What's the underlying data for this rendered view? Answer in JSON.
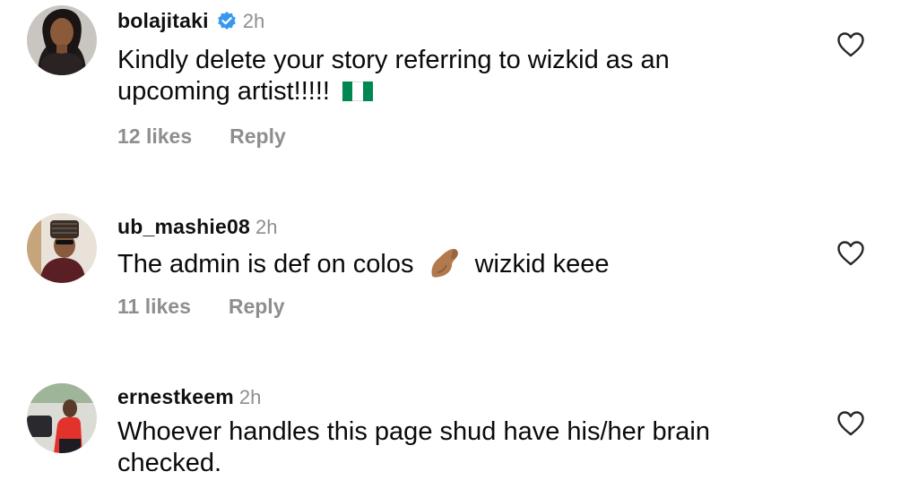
{
  "comments": [
    {
      "username": "bolajitaki",
      "verified": true,
      "time": "2h",
      "text": "Kindly delete your story referring to wizkid as an upcoming artist!!!!!",
      "emoji": "nigeria-flag",
      "likes": "12 likes",
      "reply": "Reply"
    },
    {
      "username": "ub_mashie08",
      "verified": false,
      "time": "2h",
      "text_before": "The admin is def on colos",
      "emoji": "pinched-fingers-medium-skin",
      "text_after": "wizkid keee",
      "likes": "11 likes",
      "reply": "Reply"
    },
    {
      "username": "ernestkeem",
      "verified": false,
      "time": "2h",
      "text": "Whoever handles this page shud have his/her brain checked."
    }
  ],
  "icons": {
    "like": "heart-outline-icon",
    "verified": "verified-badge-icon"
  },
  "colors": {
    "verified_blue": "#3897f0",
    "muted_text": "#8e8e8e",
    "flag_green": "#008751"
  }
}
